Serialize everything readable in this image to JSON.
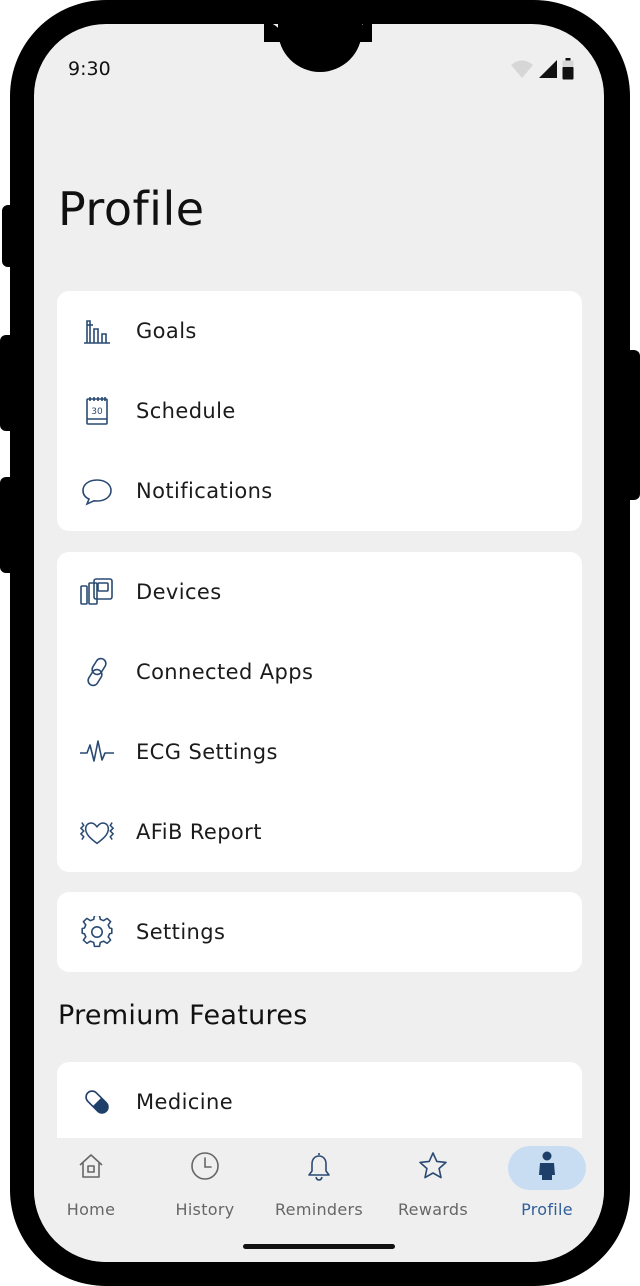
{
  "status_bar": {
    "time": "9:30",
    "icons": [
      "wifi-icon",
      "signal-icon",
      "battery-icon"
    ]
  },
  "page_title": "Profile",
  "groups": [
    {
      "items": [
        {
          "label": "Goals",
          "icon": "goals-chart-icon"
        },
        {
          "label": "Schedule",
          "icon": "calendar-icon",
          "icon_text": "30"
        },
        {
          "label": "Notifications",
          "icon": "speech-bubble-icon"
        }
      ]
    },
    {
      "items": [
        {
          "label": "Devices",
          "icon": "devices-icon"
        },
        {
          "label": "Connected Apps",
          "icon": "link-icon"
        },
        {
          "label": "ECG Settings",
          "icon": "ecg-wave-icon"
        },
        {
          "label": "AFiB Report",
          "icon": "heart-report-icon"
        }
      ]
    },
    {
      "items": [
        {
          "label": "Settings",
          "icon": "gear-icon"
        }
      ]
    }
  ],
  "premium": {
    "title": "Premium Features",
    "items": [
      {
        "label": "Medicine",
        "icon": "pill-icon"
      }
    ]
  },
  "tabs": [
    {
      "label": "Home",
      "icon": "home-icon",
      "active": false
    },
    {
      "label": "History",
      "icon": "clock-icon",
      "active": false
    },
    {
      "label": "Reminders",
      "icon": "bell-icon",
      "active": false
    },
    {
      "label": "Rewards",
      "icon": "star-icon",
      "active": false
    },
    {
      "label": "Profile",
      "icon": "person-icon",
      "active": true
    }
  ],
  "colors": {
    "icon_stroke": "#2a4a73",
    "active_tab_bg": "#c9ddf2",
    "active_tab_text": "#2f5f99",
    "screen_bg": "#efefef",
    "card_bg": "#ffffff"
  }
}
